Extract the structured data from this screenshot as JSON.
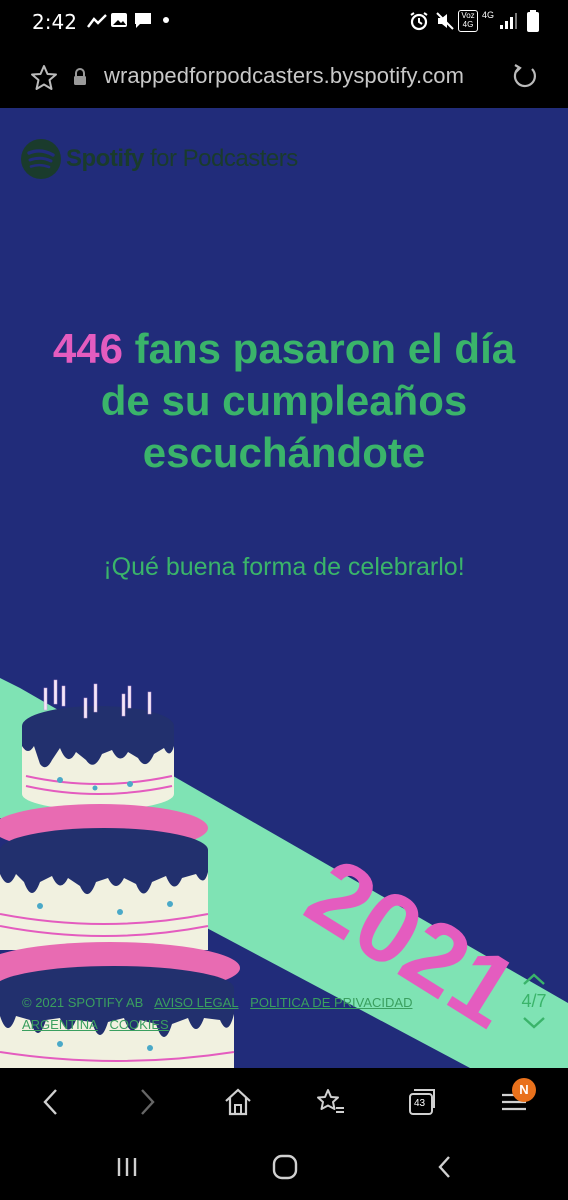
{
  "status_bar": {
    "time": "2:42",
    "left_icons": [
      "activity-icon",
      "image-icon",
      "message-icon",
      "dot-icon"
    ],
    "right_icons": [
      "alarm-icon",
      "mute-icon",
      "volte-icon",
      "4g-icon",
      "signal-icon",
      "battery-icon"
    ],
    "volte_label": "Voz 4G",
    "network_label": "4G"
  },
  "browser": {
    "url": "wrappedforpodcasters.byspotify.com",
    "tab_count": "43",
    "notification_badge": "N"
  },
  "page": {
    "brand": {
      "name_bold": "Spotify",
      "name_rest": " for Podcasters"
    },
    "headline_number": "446",
    "headline_text": " fans pasaron el día de su cumpleaños escuchándote",
    "subline": "¡Qué buena forma de celebrarlo!",
    "footer_links": [
      "© 2021 SPOTIFY AB",
      "AVISO LEGAL",
      "POLITICA DE PRIVACIDAD",
      "ARGENTINA",
      "COOKIES"
    ],
    "pager": "4/7",
    "colors": {
      "background": "#212c7a",
      "green": "#3ab46a",
      "pink": "#e45cbf",
      "mint": "#7fe3b4"
    }
  }
}
